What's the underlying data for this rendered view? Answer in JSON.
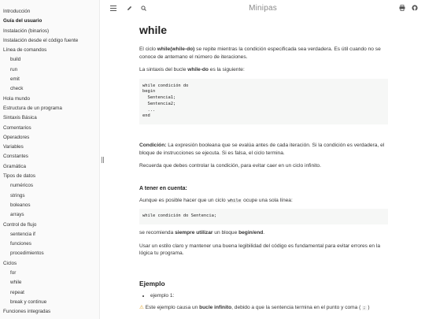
{
  "book_title": "Minipas",
  "topbar": {
    "menu_icon": "menu-icon",
    "edit_icon": "edit-icon",
    "search_icon": "search-icon",
    "print_icon": "print-icon",
    "github_icon": "github-icon"
  },
  "sidebar": {
    "items": [
      {
        "label": "Introducción",
        "level": 0,
        "bold": false
      },
      {
        "label": "Guía del usuario",
        "level": 0,
        "bold": true
      },
      {
        "label": "Instalación (binarios)",
        "level": 0,
        "bold": false
      },
      {
        "label": "Instalación desde el código fuente",
        "level": 0,
        "bold": false
      },
      {
        "label": "Línea de comandos",
        "level": 0,
        "bold": false
      },
      {
        "label": "build",
        "level": 1,
        "bold": false
      },
      {
        "label": "run",
        "level": 1,
        "bold": false
      },
      {
        "label": "emit",
        "level": 1,
        "bold": false
      },
      {
        "label": "check",
        "level": 1,
        "bold": false
      },
      {
        "label": "Hola mundo",
        "level": 0,
        "bold": false
      },
      {
        "label": "Estructura de un programa",
        "level": 0,
        "bold": false
      },
      {
        "label": "Sintaxis Básica",
        "level": 0,
        "bold": false
      },
      {
        "label": "Comentarios",
        "level": 0,
        "bold": false
      },
      {
        "label": "Operadores",
        "level": 0,
        "bold": false
      },
      {
        "label": "Variables",
        "level": 0,
        "bold": false
      },
      {
        "label": "Constantes",
        "level": 0,
        "bold": false
      },
      {
        "label": "Gramática",
        "level": 0,
        "bold": false
      },
      {
        "label": "Tipos de datos",
        "level": 0,
        "bold": false
      },
      {
        "label": "numéricos",
        "level": 1,
        "bold": false
      },
      {
        "label": "strings",
        "level": 1,
        "bold": false
      },
      {
        "label": "boleanos",
        "level": 1,
        "bold": false
      },
      {
        "label": "arrays",
        "level": 1,
        "bold": false
      },
      {
        "label": "Control de flujo",
        "level": 0,
        "bold": false
      },
      {
        "label": "sentencia if",
        "level": 1,
        "bold": false
      },
      {
        "label": "funciones",
        "level": 1,
        "bold": false
      },
      {
        "label": "procedimientos",
        "level": 1,
        "bold": false
      },
      {
        "label": "Ciclos",
        "level": 0,
        "bold": false
      },
      {
        "label": "for",
        "level": 1,
        "bold": false
      },
      {
        "label": "while",
        "level": 1,
        "bold": false
      },
      {
        "label": "repeat",
        "level": 1,
        "bold": false
      },
      {
        "label": "break y continue",
        "level": 1,
        "bold": false
      },
      {
        "label": "Funciones integradas",
        "level": 0,
        "bold": false
      }
    ]
  },
  "content": {
    "title": "while",
    "intro": {
      "pre": "El ciclo ",
      "strong": "while(while-do)",
      "post": " se repite mientras la condición especificada sea verdadera. Es útil cuando no se conoce de antemano el número de iteraciones."
    },
    "syntax_text": {
      "pre": "La sintaxis del bucle ",
      "strong": "while-do",
      "post": " es la siguiente:"
    },
    "code1": "while condición do\nbegin\n  Sentencia1;\n  Sentencia2;\n  ...\nend",
    "condition": {
      "strong": "Condición:",
      "post": " La expresión booleana que se evalúa antes de cada iteración. Si la condición es verdadera, el bloque de instrucciones se ejecuta. Si es falsa, el ciclo termina."
    },
    "reminder": "Recuerda que debes controlar la condición, para evitar caer en un ciclo infinito.",
    "note_heading": "A tener en cuenta:",
    "note_text": {
      "pre": "Aunque es posible hacer que un ciclo ",
      "code": "while",
      "post": " ocupe una sola línea:"
    },
    "code2": "while condición do Sentencia;",
    "recommend": {
      "pre": "se recomienda ",
      "strong1": "siempre utilizar",
      "mid": " un bloque ",
      "strong2": "begin/end",
      "post": "."
    },
    "style_text": "Usar un estilo claro y mantener una buena legibilidad del código es fundamental para evitar errores en la lógica tu programa.",
    "example_heading": "Ejemplo",
    "example_items": [
      "ejemplo 1:"
    ],
    "warning": {
      "icon": "warning-icon",
      "pre": " Este ejemplo causa un ",
      "strong": "bucle infinito",
      "post": ", debido a que la sentencia termina en el punto y coma ( ",
      "code": ";",
      "end": " )"
    }
  }
}
